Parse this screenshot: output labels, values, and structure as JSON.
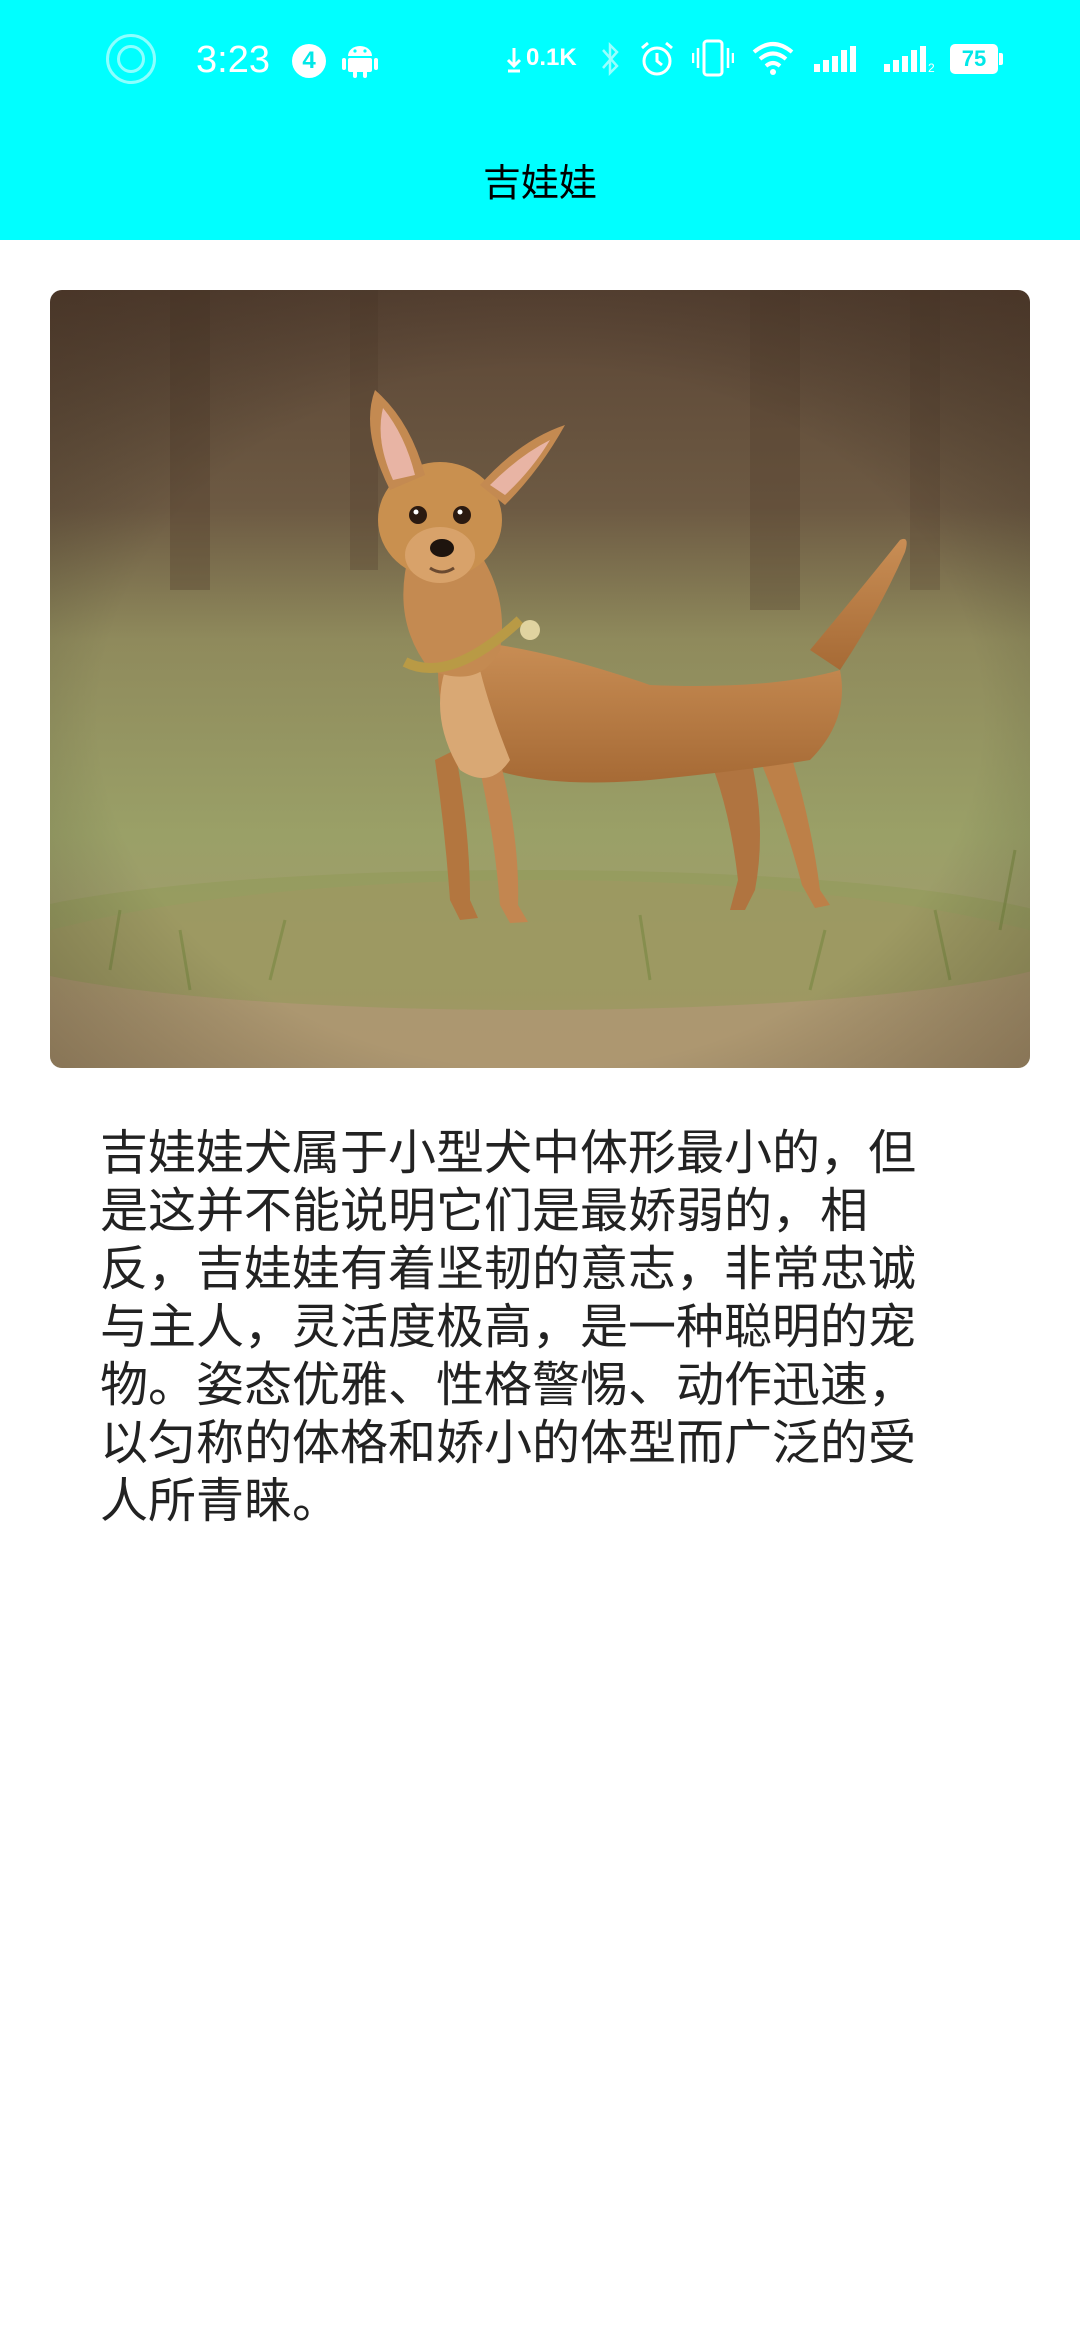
{
  "status_bar": {
    "time": "3:23",
    "notification_count": "4",
    "net_speed": "0.1K",
    "battery": "75",
    "icons": [
      "ring-icon",
      "android-icon",
      "download-arrow-icon",
      "bluetooth-icon",
      "alarm-icon",
      "vibrate-icon",
      "wifi-icon",
      "signal-icon",
      "signal-2-icon",
      "battery-icon"
    ]
  },
  "app_bar": {
    "title": "吉娃娃",
    "color": "#00ffff"
  },
  "content": {
    "image_subject": "dog-photo",
    "description": "吉娃娃犬属于小型犬中体形最小的，但是这并不能说明它们是最娇弱的，相反，吉娃娃有着坚韧的意志，非常忠诚与主人，灵活度极高，是一种聪明的宠物。姿态优雅、性格警惕、动作迅速，以匀称的体格和娇小的体型而广泛的受人所青睐。"
  }
}
